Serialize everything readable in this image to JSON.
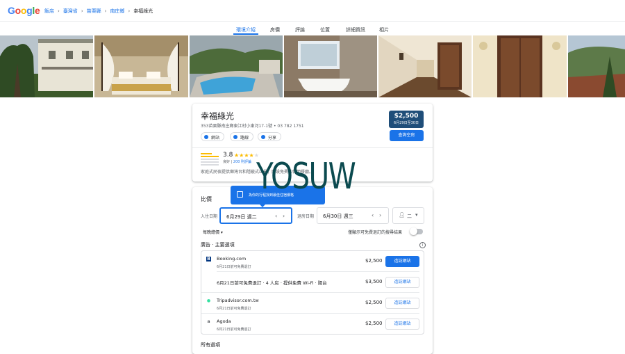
{
  "header": {
    "logo": [
      "G",
      "o",
      "o",
      "g",
      "l",
      "e"
    ],
    "logo_colors": [
      "#4285F4",
      "#EA4335",
      "#FBBC05",
      "#4285F4",
      "#34A853",
      "#EA4335"
    ],
    "breadcrumbs": [
      "飯店",
      "臺灣省",
      "苗栗縣",
      "南庄鄉",
      "幸福綠光"
    ]
  },
  "tabs": [
    "環境介紹",
    "房價",
    "評論",
    "位置",
    "詳細資訊",
    "相片"
  ],
  "hotel": {
    "name": "幸福綠光",
    "address": "353苗栗縣南庄鄉東江村小東河17-1號 • 03 782 1751",
    "chips": [
      "網站",
      "路線",
      "分享"
    ],
    "price": "$2,500",
    "price_dates": "6月29日至30日",
    "check_button": "查詢空房",
    "rating": "3.8",
    "rating_word": "良好",
    "reviews_link": "200 則評論",
    "description": "家庭式民宿提供鄉灣台和隱蔽式山景，附設免費和休閒餐廳。"
  },
  "watermark": "YOSUW",
  "pricing": {
    "title": "比價",
    "tooltip": "為你的行程找到最佳住宿價格",
    "checkin_label": "入住日期",
    "checkin": "6月29日 週二",
    "checkout_label": "退房日期",
    "checkout": "6月30日 週三",
    "guests": "二",
    "nightly": "每晚總價",
    "free_cancel_label": "僅顯示可免費退訂的搜尋結果",
    "featured_title": "廣告 · 主要選項",
    "offers": [
      {
        "logo": "B",
        "logo_color": "#003580",
        "name": "Booking.com",
        "sub": "6月21日前可免費退訂",
        "price": "$2,500",
        "button": "造訪網站",
        "primary": true
      },
      {
        "logo": "",
        "logo_color": "",
        "name": "6月21日前可免費退訂 · 4 人房 · 提供免費 Wi-Fi · 陽台",
        "sub": "",
        "price": "$3,500",
        "button": "造訪網站",
        "primary": false
      },
      {
        "logo": "●",
        "logo_color": "#34E0A1",
        "name": "Tripadvisor.com.tw",
        "sub": "6月21日前可免費退訂",
        "price": "$2,500",
        "button": "造訪網站",
        "primary": false
      },
      {
        "logo": "a",
        "logo_color": "#5f6368",
        "name": "Agoda",
        "sub": "6月21日前可免費退訂",
        "price": "$2,500",
        "button": "造訪網站",
        "primary": false
      }
    ],
    "all_options": "所有選項"
  }
}
